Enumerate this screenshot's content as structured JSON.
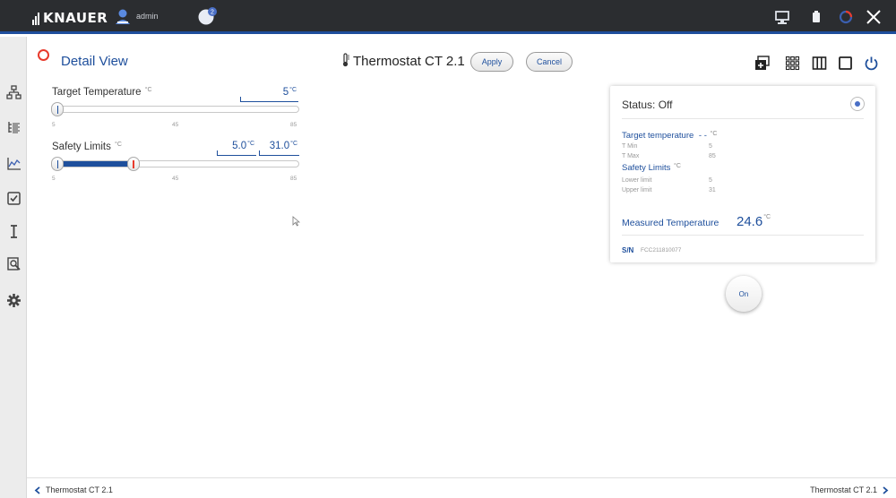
{
  "topbar": {
    "brand": "KNAUER",
    "username": "admin",
    "icons": [
      "user-icon",
      "notification-icon",
      "screen-share-icon",
      "battery-icon",
      "connection-status-icon",
      "close-icon"
    ]
  },
  "sidebar": {
    "items": [
      "network-icon",
      "tree-list-icon",
      "chart-icon",
      "checklist-icon",
      "text-cursor-icon",
      "zoom-document-icon",
      "settings-gear-icon"
    ]
  },
  "header": {
    "view_title": "Detail View",
    "device_title": "Thermostat CT 2.1",
    "apply_label": "Apply",
    "cancel_label": "Cancel",
    "icons": [
      "add-window-icon",
      "grid-view-icon",
      "columns-view-icon",
      "single-view-icon",
      "power-icon"
    ]
  },
  "target_temp": {
    "label": "Target Temperature",
    "unit": "°C",
    "value": "5",
    "min": "5",
    "mid": "45",
    "max": "85",
    "slider_fraction": 0.0
  },
  "safety_limits": {
    "label": "Safety Limits",
    "unit": "°C",
    "lower": "5.0",
    "upper": "31.0",
    "min": "5",
    "mid": "45",
    "max": "85"
  },
  "panel": {
    "status": "Status: Off",
    "target_head": "Target temperature",
    "target_val": "- -",
    "unit": "°C",
    "tmin_label": "T Min",
    "tmin_val": "5",
    "tmax_label": "T Max",
    "tmax_val": "85",
    "limits_head": "Safety Limits",
    "lower_label": "Lower limit",
    "lower_val": "5",
    "upper_label": "Upper limit",
    "upper_val": "31",
    "measured_label": "Measured Temperature",
    "measured_val": "24.6",
    "sn_label": "S/N",
    "sn_val": "FCC211810077"
  },
  "on_button": "On",
  "footer": {
    "prev": "Thermostat CT 2.1",
    "next": "Thermostat CT 2.1"
  },
  "colors": {
    "accent": "#1e4f9c",
    "topbar": "#2b2d30",
    "alert": "#e83a2c"
  }
}
